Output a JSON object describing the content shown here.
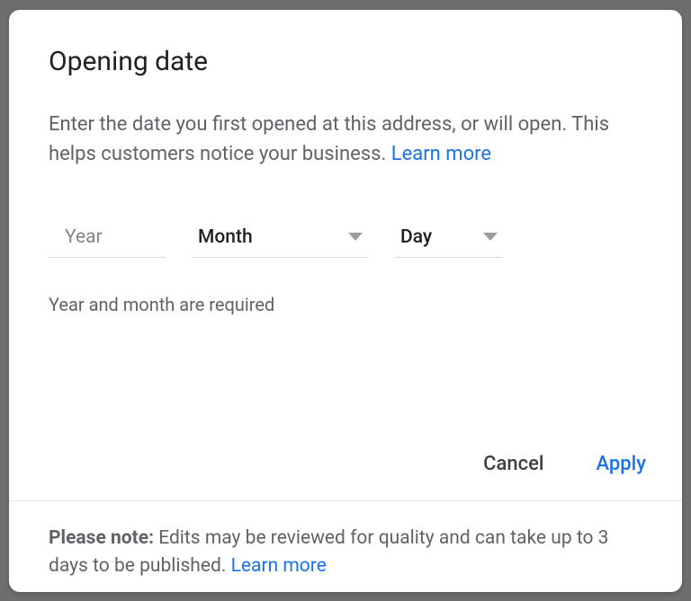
{
  "dialog": {
    "title": "Opening date",
    "description": "Enter the date you first opened at this address, or will open. This helps customers notice your business. ",
    "learnMore": "Learn more",
    "fields": {
      "yearPlaceholder": "Year",
      "monthLabel": "Month",
      "dayLabel": "Day"
    },
    "helper": "Year and month are required",
    "actions": {
      "cancel": "Cancel",
      "apply": "Apply"
    }
  },
  "footer": {
    "noteLabel": "Please note:",
    "noteText": " Edits may be reviewed for quality and can take up to 3 days to be published. ",
    "learnMore": "Learn more"
  }
}
